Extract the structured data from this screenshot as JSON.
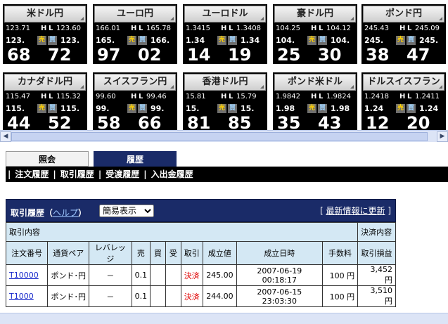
{
  "tickers": [
    {
      "name": "米ドル円",
      "high": "123.71",
      "low": "123.60",
      "bid": "123.",
      "ask": "123.",
      "sell_label": "売",
      "buy_label": "買",
      "bid_big": "68",
      "ask_big": "72"
    },
    {
      "name": "ユーロ円",
      "high": "166.01",
      "low": "165.78",
      "bid": "165.",
      "ask": "166.",
      "sell_label": "売",
      "buy_label": "買",
      "bid_big": "97",
      "ask_big": "02"
    },
    {
      "name": "ユーロドル",
      "high": "1.3415",
      "low": "1.3408",
      "bid": "1.34",
      "ask": "1.34",
      "sell_label": "売",
      "buy_label": "買",
      "bid_big": "14",
      "ask_big": "19"
    },
    {
      "name": "豪ドル円",
      "high": "104.25",
      "low": "104.12",
      "bid": "104.",
      "ask": "104.",
      "sell_label": "売",
      "buy_label": "買",
      "bid_big": "25",
      "ask_big": "30"
    },
    {
      "name": "ポンド円",
      "high": "245.43",
      "low": "245.09",
      "bid": "245.",
      "ask": "245.",
      "sell_label": "売",
      "buy_label": "買",
      "bid_big": "38",
      "ask_big": "47"
    },
    {
      "name": "カナダドル円",
      "high": "115.47",
      "low": "115.32",
      "bid": "115.",
      "ask": "115.",
      "sell_label": "売",
      "buy_label": "買",
      "bid_big": "44",
      "ask_big": "52"
    },
    {
      "name": "スイスフラン円",
      "high": "99.60",
      "low": "99.46",
      "bid": "99.",
      "ask": "99.",
      "sell_label": "売",
      "buy_label": "買",
      "bid_big": "58",
      "ask_big": "66"
    },
    {
      "name": "香港ドル円",
      "high": "15.81",
      "low": "15.79",
      "bid": "15.",
      "ask": "15.",
      "sell_label": "売",
      "buy_label": "買",
      "bid_big": "81",
      "ask_big": "85"
    },
    {
      "name": "ポンド米ドル",
      "high": "1.9842",
      "low": "1.9824",
      "bid": "1.98",
      "ask": "1.98",
      "sell_label": "売",
      "buy_label": "買",
      "bid_big": "35",
      "ask_big": "43"
    },
    {
      "name": "ドルスイスフラン",
      "high": "1.2418",
      "low": "1.2411",
      "bid": "1.24",
      "ask": "1.24",
      "sell_label": "売",
      "buy_label": "買",
      "bid_big": "12",
      "ask_big": "20"
    }
  ],
  "hl_labels": {
    "h": "H",
    "l": "L"
  },
  "tabs": [
    {
      "label": "照会"
    },
    {
      "label": "履歴"
    }
  ],
  "subnav": {
    "items": [
      "注文履歴",
      "取引履歴",
      "受渡履歴",
      "入出金履歴"
    ],
    "sep": "|"
  },
  "section": {
    "title": "取引履歴",
    "help": "ヘルプ",
    "help_open": "（",
    "help_close": "）",
    "select_value": "簡易表示",
    "refresh": "最新情報に更新",
    "refresh_open": "[",
    "refresh_close": "]"
  },
  "table": {
    "group_left": "取引内容",
    "group_right": "決済内容",
    "columns": [
      "注文番号",
      "通貨ペア",
      "レバレッジ",
      "売",
      "買",
      "受",
      "取引",
      "成立値",
      "成立日時",
      "手数料",
      "取引損益"
    ],
    "rows": [
      {
        "id": "T10000",
        "pair": "ポンド･円",
        "lev": "－",
        "sell": "0.1",
        "buy": "",
        "rcv": "",
        "trade": "決済",
        "price": "245.00",
        "datetime": "2007-06-19 00:18:17",
        "fee": "100 円",
        "pl": "3,452 円"
      },
      {
        "id": "T1000",
        "pair": "ポンド･円",
        "lev": "－",
        "sell": "0.1",
        "buy": "",
        "rcv": "",
        "trade": "決済",
        "price": "244.00",
        "datetime": "2007-06-15 23:03:30",
        "fee": "100 円",
        "pl": "3,510 円"
      }
    ]
  }
}
